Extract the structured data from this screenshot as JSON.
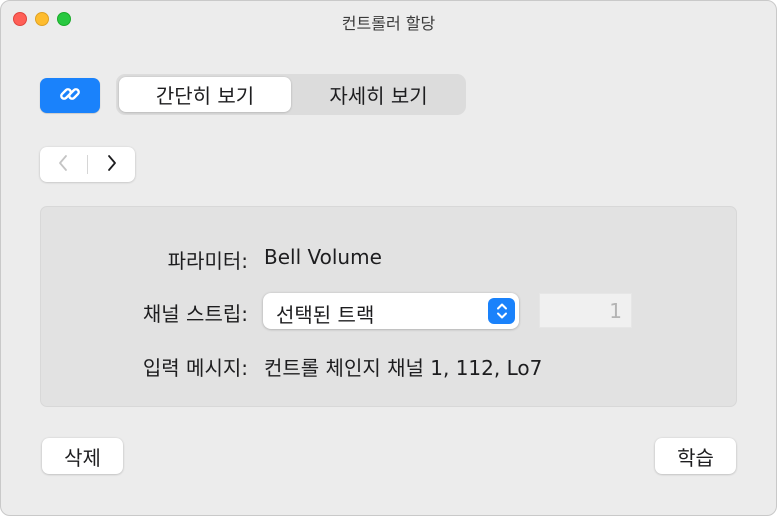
{
  "window": {
    "title": "컨트롤러 할당"
  },
  "toolbar": {
    "link_icon": "link-icon",
    "link_color": "#1a82fb",
    "view_tabs": [
      {
        "label": "간단히 보기",
        "selected": true
      },
      {
        "label": "자세히 보기",
        "selected": false
      }
    ]
  },
  "navigation": {
    "prev_icon": "chevron-left-icon",
    "next_icon": "chevron-right-icon"
  },
  "panel": {
    "parameter": {
      "label": "파라미터:",
      "value": "Bell Volume"
    },
    "channel_strip": {
      "label": "채널 스트립:",
      "value": "선택된 트랙",
      "channel_number": "1"
    },
    "input_message": {
      "label": "입력 메시지:",
      "value": "컨트롤 체인지 채널 1, 112, Lo7"
    }
  },
  "buttons": {
    "delete": "삭제",
    "learn": "학습"
  }
}
